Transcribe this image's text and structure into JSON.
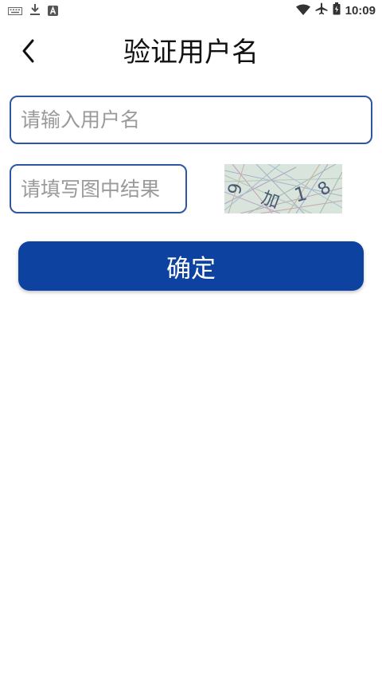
{
  "status_bar": {
    "time": "10:09",
    "left_icons": [
      "keyboard-icon",
      "download-icon",
      "a-badge-icon"
    ],
    "right_icons": [
      "wifi-icon",
      "airplane-icon",
      "battery-icon"
    ]
  },
  "header": {
    "title": "验证用户名",
    "back_icon": "chevron-left-icon"
  },
  "form": {
    "username_placeholder": "请输入用户名",
    "username_value": "",
    "captcha_placeholder": "请填写图中结果",
    "captcha_value": "",
    "captcha_image_text": "9 加 1 8",
    "confirm_label": "确定"
  },
  "colors": {
    "accent": "#0e42a0",
    "input_border": "#2e56a3",
    "placeholder": "#9a9a9a",
    "background": "#ffffff"
  }
}
